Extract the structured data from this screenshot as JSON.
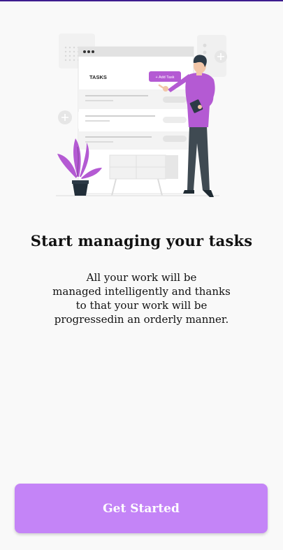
{
  "illustration": {
    "board_heading": "TASKS",
    "add_task_label": "+ Add Task",
    "accent_color": "#b45ad3"
  },
  "onboarding": {
    "title": "Start managing your tasks",
    "description_lines": [
      "All your work will be",
      "managed intelligently and thanks",
      "to that your work will be",
      "progressedin an orderly manner."
    ],
    "cta_label": "Get Started"
  },
  "colors": {
    "background": "#f9f9f9",
    "button": "#c484f7",
    "button_text": "#ffffff",
    "title_text": "#111111",
    "top_line": "#3d1c8f"
  }
}
